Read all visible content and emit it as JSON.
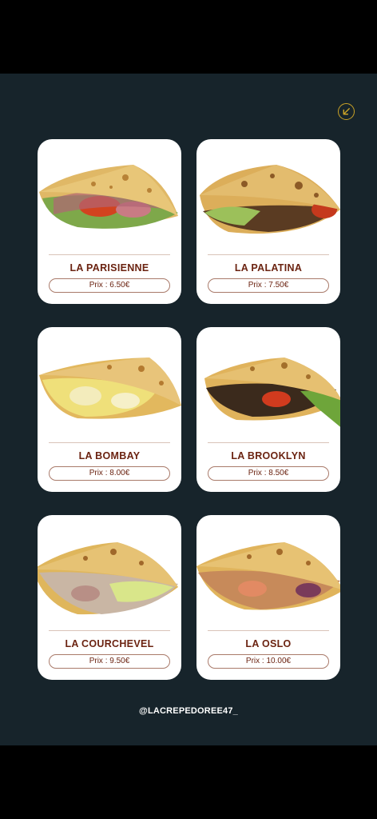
{
  "accent_color": "#c9a227",
  "back_icon": "arrow-down-left-icon",
  "products": [
    {
      "name": "LA PARISIENNE",
      "price": "Prix : 6.50€"
    },
    {
      "name": "LA PALATINA",
      "price": "Prix : 7.50€"
    },
    {
      "name": "LA BOMBAY",
      "price": "Prix : 8.00€"
    },
    {
      "name": "LA BROOKLYN",
      "price": "Prix : 8.50€"
    },
    {
      "name": "LA COURCHEVEL",
      "price": "Prix : 9.50€"
    },
    {
      "name": "LA OSLO",
      "price": "Prix : 10.00€"
    }
  ],
  "footer": {
    "handle": "@LACREPEDOREE47_"
  }
}
